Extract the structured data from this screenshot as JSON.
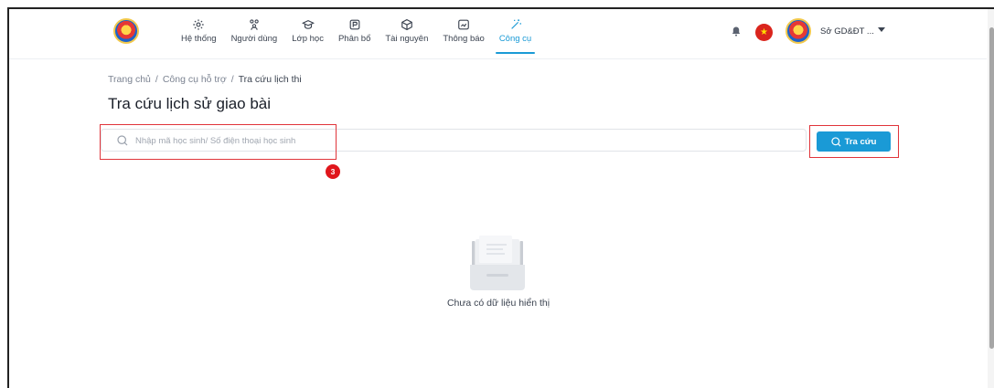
{
  "header": {
    "nav": [
      {
        "label": "Hệ thống",
        "icon": "settings-icon"
      },
      {
        "label": "Người dùng",
        "icon": "users-icon"
      },
      {
        "label": "Lớp học",
        "icon": "graduation-cap-icon"
      },
      {
        "label": "Phân bổ",
        "icon": "distribution-icon"
      },
      {
        "label": "Tài nguyên",
        "icon": "box-icon"
      },
      {
        "label": "Thông báo",
        "icon": "message-icon"
      },
      {
        "label": "Công cụ",
        "icon": "magic-wand-icon",
        "active": true
      }
    ],
    "user_name": "Sở GD&ĐT ...",
    "flag_star": "★"
  },
  "breadcrumb": {
    "items": [
      "Trang chủ",
      "Công cụ hỗ trợ",
      "Tra cứu lịch thi"
    ],
    "separator": "/"
  },
  "page": {
    "title": "Tra cứu lịch sử giao bài"
  },
  "search": {
    "placeholder": "Nhập mã học sinh/ Số điện thoại học sinh",
    "value": "",
    "button_label": "Tra cứu"
  },
  "annotation": {
    "step_number": "3"
  },
  "empty_state": {
    "message": "Chưa có dữ liệu hiển thị"
  },
  "colors": {
    "accent": "#1a9ad6",
    "highlight": "#e0343a",
    "badge": "#e0161c"
  }
}
